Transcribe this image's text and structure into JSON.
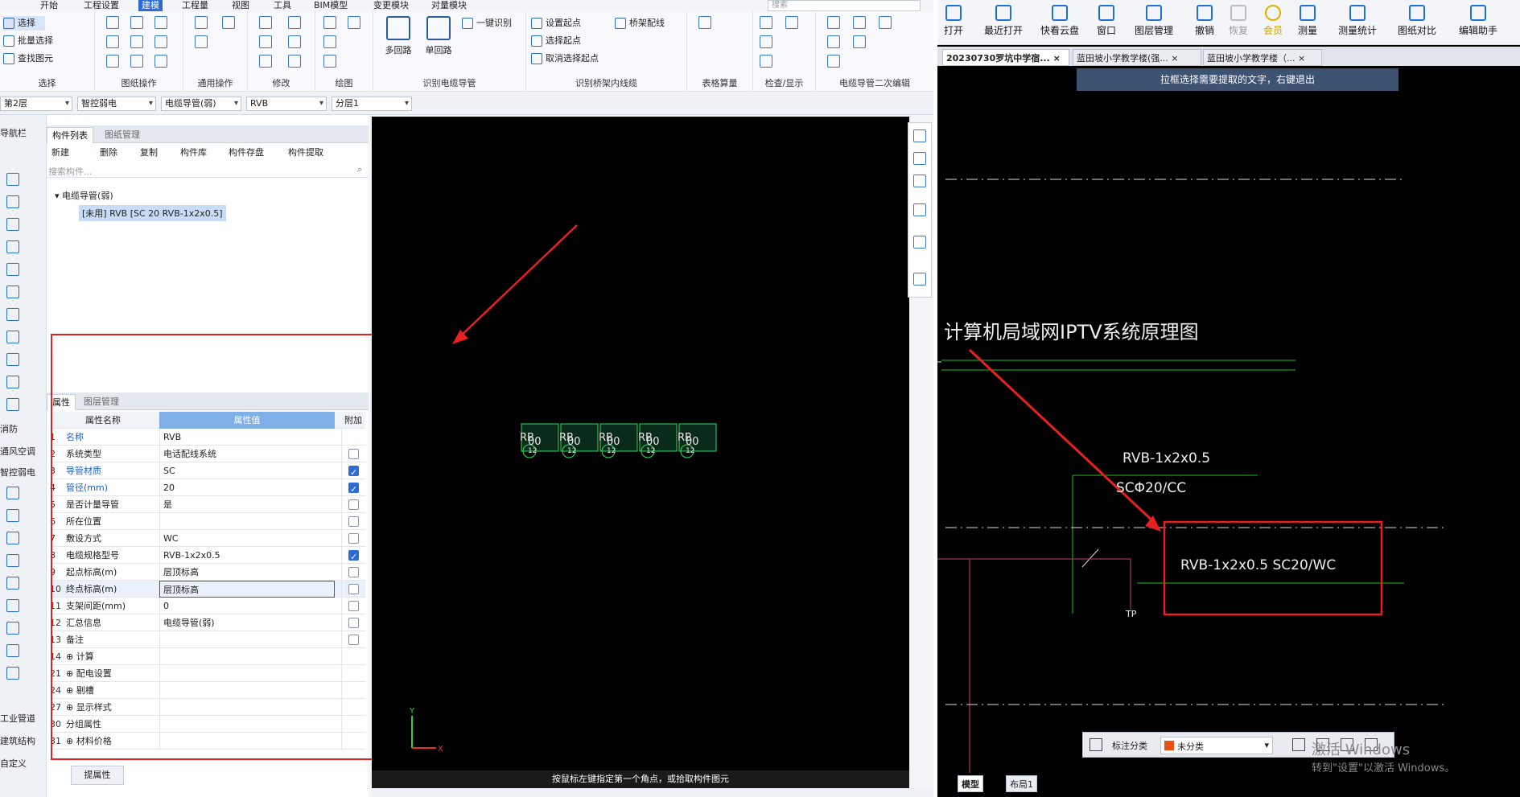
{
  "menu": [
    "开始",
    "工程设置",
    "建模",
    "工程量",
    "视图",
    "工具",
    "BIM模型",
    "变更模块",
    "对量模块"
  ],
  "search_placeholder": "搜索",
  "ribbon": {
    "select": {
      "label": "选择",
      "items": [
        "选择",
        "批量选择",
        "查找图元"
      ]
    },
    "primitive": {
      "label": "图纸操作"
    },
    "general": {
      "label": "通用操作"
    },
    "modify": {
      "label": "修改"
    },
    "draw": {
      "label": "绘图"
    },
    "identify": {
      "label": "识别电缆导管",
      "multi": "多回路",
      "single": "单回路",
      "onekey": "一键识别"
    },
    "bridge": {
      "label": "识别桥架内线缆",
      "items": [
        "设置起点",
        "选择起点",
        "取消选择起点"
      ],
      "bridgeline": "桥架配线"
    },
    "table": {
      "label": "表格算量"
    },
    "check": {
      "label": "检查/显示"
    },
    "edit2": {
      "label": "电缆导管二次编辑"
    }
  },
  "toolrow": {
    "floor": "第2层",
    "category": "智控弱电",
    "type": "电缆导管(弱)",
    "name": "RVB",
    "layer": "分层1"
  },
  "side": {
    "nav": "导航栏",
    "items": [
      "消防",
      "通风空调",
      "智控弱电",
      "工业管道",
      "建筑结构",
      "自定义"
    ]
  },
  "panel": {
    "tabs": [
      "构件列表",
      "图纸管理"
    ],
    "tools": [
      "新建",
      "删除",
      "复制",
      "构件库",
      "构件存盘",
      "构件提取"
    ],
    "search": "搜索构件...",
    "tree_parent": "电缆导管(弱)",
    "tree_child": "[未用] RVB [SC 20 RVB-1x2x0.5]"
  },
  "props": {
    "tabs": [
      "属性",
      "图层管理"
    ],
    "headers": [
      "属性名称",
      "属性值",
      "附加"
    ],
    "rows": [
      {
        "n": "1",
        "name": "名称",
        "val": "RVB",
        "blue": true,
        "cb": null
      },
      {
        "n": "2",
        "name": "系统类型",
        "val": "电话配线系统",
        "blue": false,
        "cb": false
      },
      {
        "n": "3",
        "name": "导管材质",
        "val": "SC",
        "blue": true,
        "cb": true
      },
      {
        "n": "4",
        "name": "管径(mm)",
        "val": "20",
        "blue": true,
        "cb": true
      },
      {
        "n": "5",
        "name": "是否计量导管",
        "val": "是",
        "blue": false,
        "cb": false
      },
      {
        "n": "6",
        "name": "所在位置",
        "val": "",
        "blue": false,
        "cb": false
      },
      {
        "n": "7",
        "name": "敷设方式",
        "val": "WC",
        "blue": false,
        "cb": false
      },
      {
        "n": "8",
        "name": "电缆规格型号",
        "val": "RVB-1x2x0.5",
        "blue": false,
        "cb": true
      },
      {
        "n": "9",
        "name": "起点标高(m)",
        "val": "层顶标高",
        "blue": false,
        "cb": false
      },
      {
        "n": "10",
        "name": "终点标高(m)",
        "val": "层顶标高",
        "blue": false,
        "cb": false
      },
      {
        "n": "11",
        "name": "支架间距(mm)",
        "val": "0",
        "blue": false,
        "cb": false
      },
      {
        "n": "12",
        "name": "汇总信息",
        "val": "电缆导管(弱)",
        "blue": false,
        "cb": false
      },
      {
        "n": "13",
        "name": "备注",
        "val": "",
        "blue": false,
        "cb": false
      },
      {
        "n": "14",
        "name": "⊕ 计算",
        "val": "",
        "blue": false,
        "cb": null
      },
      {
        "n": "21",
        "name": "⊕ 配电设置",
        "val": "",
        "blue": false,
        "cb": null
      },
      {
        "n": "24",
        "name": "⊕ 剔槽",
        "val": "",
        "blue": false,
        "cb": null
      },
      {
        "n": "27",
        "name": "⊕ 显示样式",
        "val": "",
        "blue": false,
        "cb": null
      },
      {
        "n": "30",
        "name": "分组属性",
        "val": "",
        "blue": false,
        "cb": null
      },
      {
        "n": "31",
        "name": "⊕ 材料价格",
        "val": "",
        "blue": false,
        "cb": null
      }
    ],
    "extract_btn": "提属性"
  },
  "canvas_status": "按鼠标左键指定第一个角点，或拾取构件图元",
  "canvas_labels": [
    "RB",
    "00",
    "12",
    "RB",
    "00",
    "12",
    "RB",
    "00",
    "12",
    "RB",
    "00",
    "12",
    "RB",
    "00",
    "12"
  ],
  "right": {
    "toolbar": [
      "打开",
      "最近打开",
      "快看云盘",
      "窗口",
      "图层管理",
      "撤销",
      "恢复",
      "会员",
      "测量",
      "测量统计",
      "图纸对比",
      "编辑助手"
    ],
    "tabs": [
      "20230730罗坑中学宿...",
      "蓝田坡小学教学楼(强...",
      "蓝田坡小学教学楼（..."
    ],
    "hint": "拉框选择需要提取的文字，右键退出",
    "title": "计算机局域网IPTV系统原理图",
    "text1": "RVB-1x2x0.5",
    "text2": "SCΦ20/CC",
    "text3": "RVB-1x2x0.5  SC20/WC",
    "tp": "TP",
    "label_class": "标注分类",
    "label_value": "未分类",
    "watermark1": "激活 Windows",
    "watermark2": "转到\"设置\"以激活 Windows。",
    "bottom_tabs": [
      "模型",
      "布局1"
    ]
  }
}
